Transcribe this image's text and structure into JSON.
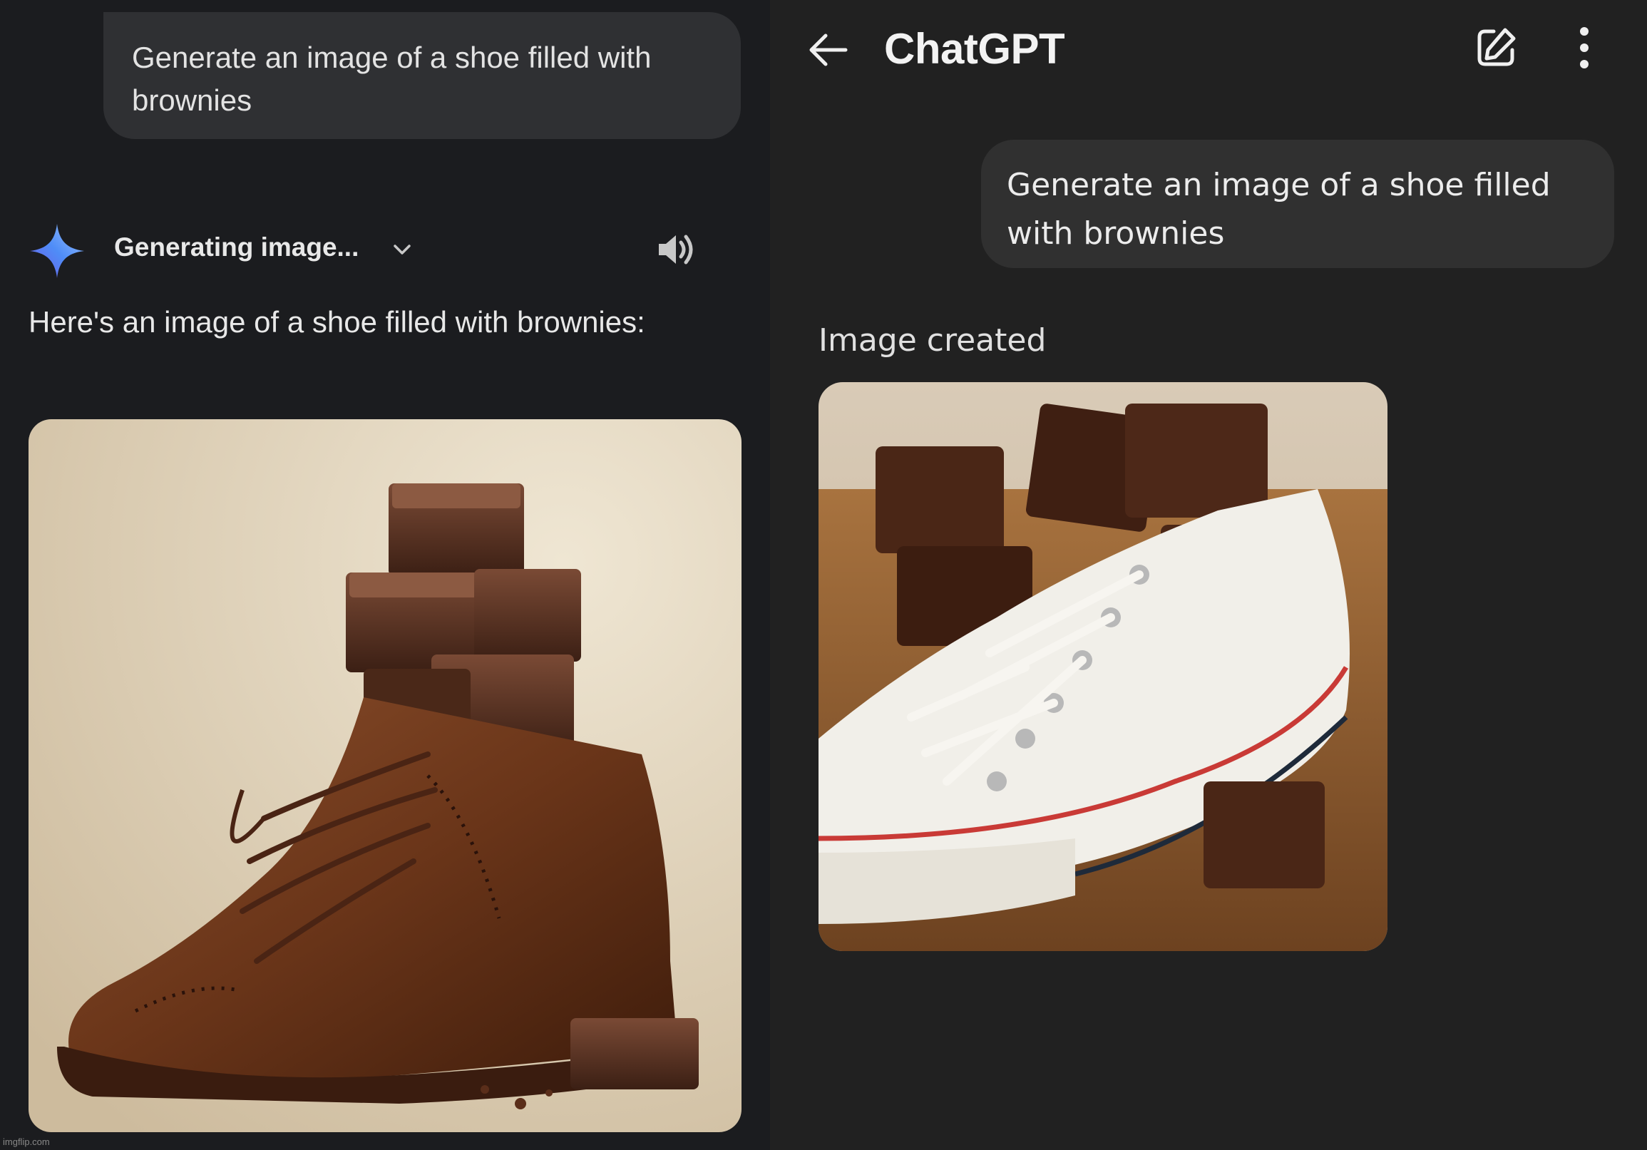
{
  "gemini": {
    "user_message": "Generate an image of a shoe filled with brownies",
    "status_label": "Generating image...",
    "icons": {
      "spark": "gemini-spark-icon",
      "expand": "chevron-down-icon",
      "audio": "speaker-icon"
    },
    "reply_text": "Here's an image of a shoe filled with brownies:",
    "image_alt": "brown leather wingtip shoe filled with stacked brownies",
    "watermark": "imgflip.com"
  },
  "chatgpt": {
    "title": "ChatGPT",
    "icons": {
      "back": "arrow-left-icon",
      "new_chat": "edit-icon",
      "menu": "more-vertical-icon"
    },
    "user_message": "Generate an image of a shoe filled with brownies",
    "status_label": "Image created",
    "image_alt": "white canvas sneaker filled with brownies on wooden table"
  },
  "colors": {
    "gemini_bg": "#1b1c1f",
    "chatgpt_bg": "#212121",
    "gemini_bubble": "#2f3033",
    "chatgpt_bubble": "#303030",
    "gemini_spark_blue": "#4f8df7"
  }
}
